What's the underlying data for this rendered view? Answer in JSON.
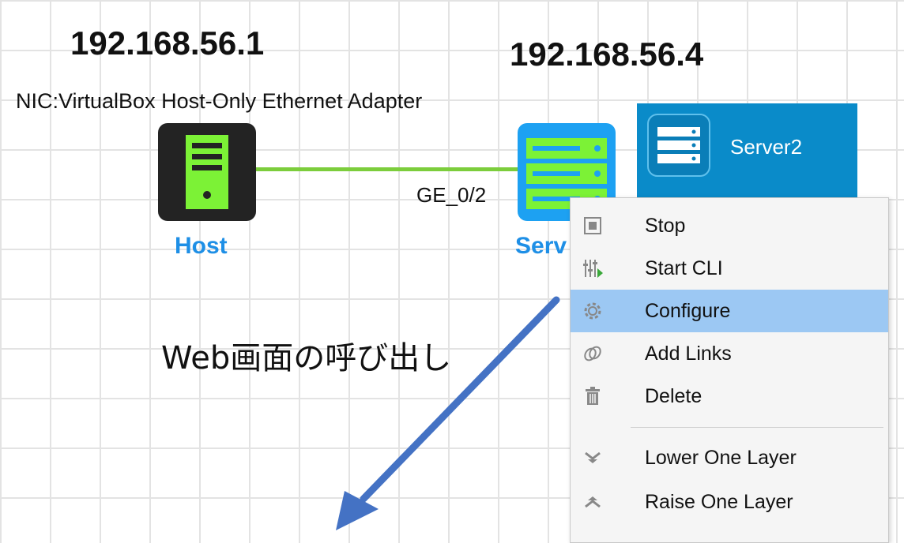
{
  "canvas": {
    "host": {
      "ip": "192.168.56.1",
      "nic": "NIC:VirtualBox Host-Only Ethernet Adapter",
      "label": "Host"
    },
    "server": {
      "ip": "192.168.56.4",
      "label": "Serv",
      "port": "GE_0/2"
    },
    "tooltip": {
      "name": "Server2"
    },
    "annotation": "Web画面の呼び出し"
  },
  "context_menu": {
    "items": [
      {
        "label": "Stop",
        "icon": "stop-icon"
      },
      {
        "label": "Start CLI",
        "icon": "cli-icon"
      },
      {
        "label": "Configure",
        "icon": "gear-icon",
        "highlighted": true
      },
      {
        "label": "Add Links",
        "icon": "link-icon"
      },
      {
        "label": "Delete",
        "icon": "trash-icon"
      },
      {
        "label": "Lower One Layer",
        "icon": "chevron-down-icon"
      },
      {
        "label": "Raise One Layer",
        "icon": "chevron-up-icon"
      }
    ]
  },
  "colors": {
    "link": "#7ccd3c",
    "host_label": "#1e8fe6",
    "tooltip_bg": "#0a8bc9",
    "menu_highlight": "#9cc8f3",
    "arrow": "#4472c4"
  }
}
